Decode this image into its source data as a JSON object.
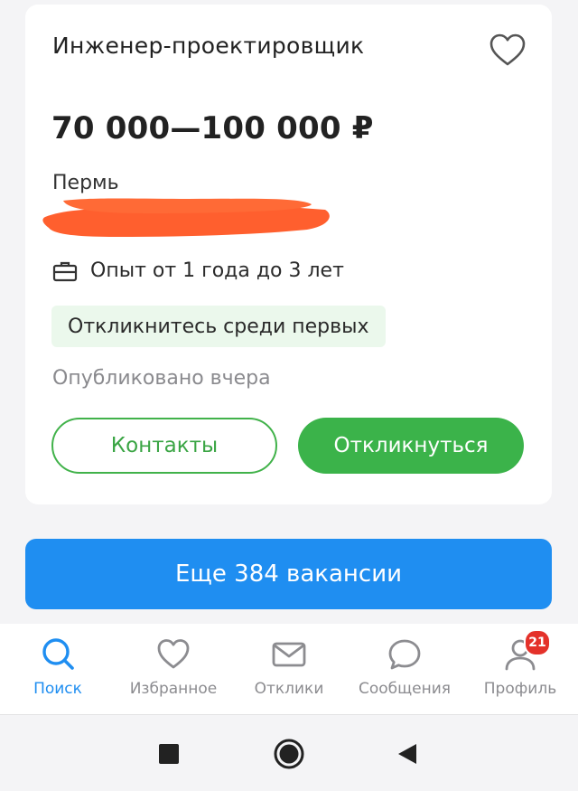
{
  "vacancy": {
    "title": "Инженер-проектировщик",
    "salary": "70 000—100 000 ₽",
    "city": "Пермь",
    "experience": "Опыт от 1 года до 3 лет",
    "badge": "Откликнитесь среди первых",
    "published": "Опубликовано вчера",
    "contacts_label": "Контакты",
    "apply_label": "Откликнуться"
  },
  "more_button": "Еще 384 вакансии",
  "tabs": [
    {
      "label": "Поиск",
      "icon": "search-icon",
      "active": true
    },
    {
      "label": "Избранное",
      "icon": "heart-icon"
    },
    {
      "label": "Отклики",
      "icon": "envelope-icon"
    },
    {
      "label": "Сообщения",
      "icon": "chat-bubble-icon"
    },
    {
      "label": "Профиль",
      "icon": "profile-icon",
      "badge": "21"
    }
  ],
  "colors": {
    "accent_green": "#3bb34a",
    "accent_blue": "#1f8ef1",
    "badge_bg": "#ebf8ec",
    "notification_red": "#e4312a",
    "redaction": "#ff5f2e"
  }
}
